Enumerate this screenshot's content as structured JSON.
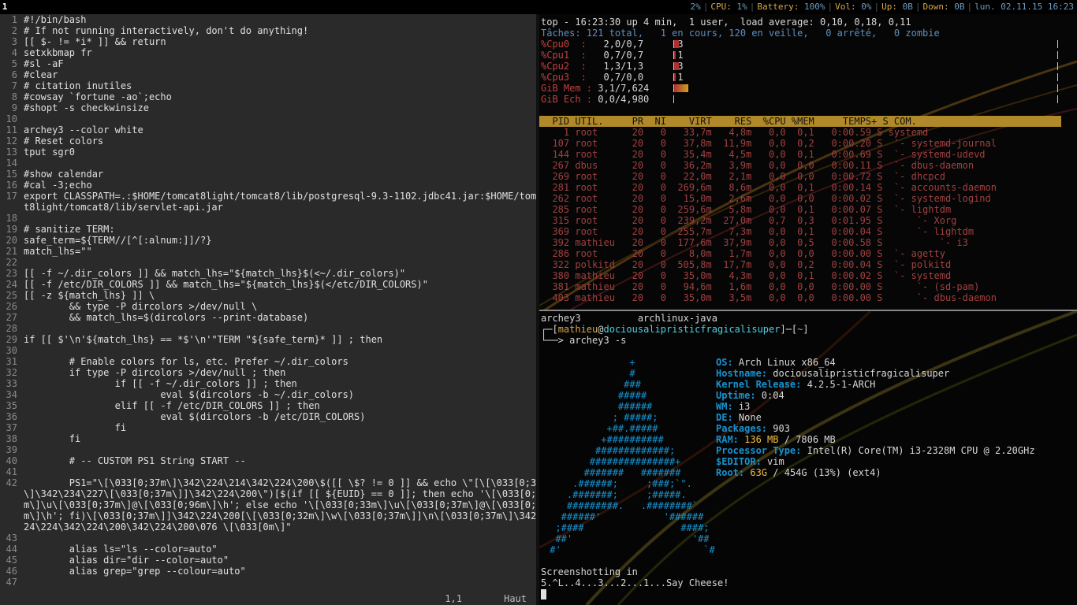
{
  "topbar": {
    "workspace": "1",
    "status": [
      {
        "label": "",
        "value": "2%"
      },
      {
        "label": "CPU:",
        "value": "1%"
      },
      {
        "label": "Battery:",
        "value": "100%"
      },
      {
        "label": "Vol:",
        "value": "0%"
      },
      {
        "label": "Up:",
        "value": "0B"
      },
      {
        "label": "Down:",
        "value": "0B"
      },
      {
        "label": "",
        "value": "lun. 02.11.15  16:23"
      }
    ]
  },
  "vim": {
    "lines": [
      {
        "n": "1",
        "t": "#!/bin/bash",
        "c": "comment"
      },
      {
        "n": "2",
        "t": "# If not running interactively, don't do anything!",
        "c": "comment"
      },
      {
        "n": "3",
        "t": "[[ $- != *i* ]] && return",
        "c": "kw"
      },
      {
        "n": "4",
        "t": "setxkbmap fr",
        "c": ""
      },
      {
        "n": "5",
        "t": "#sl -aF",
        "c": "comment"
      },
      {
        "n": "6",
        "t": "#clear",
        "c": "comment"
      },
      {
        "n": "7",
        "t": "# citation inutiles",
        "c": "comment"
      },
      {
        "n": "8",
        "t": "#cowsay `fortune -ao`;echo",
        "c": "comment"
      },
      {
        "n": "9",
        "t": "#shopt -s checkwinsize",
        "c": "comment"
      },
      {
        "n": "10",
        "t": "",
        "c": ""
      },
      {
        "n": "11",
        "t": "archey3 --color white",
        "c": ""
      },
      {
        "n": "12",
        "t": "# Reset colors",
        "c": "comment"
      },
      {
        "n": "13",
        "t": "tput sgr0",
        "c": ""
      },
      {
        "n": "14",
        "t": "",
        "c": ""
      },
      {
        "n": "15",
        "t": "#show calendar",
        "c": "comment"
      },
      {
        "n": "16",
        "t": "#cal -3;echo",
        "c": "comment"
      },
      {
        "n": "17",
        "t": "export CLASSPATH=.:$HOME/tomcat8light/tomcat8/lib/postgresql-9.3-1102.jdbc41.jar:$HOME/tomca",
        "c": "var"
      },
      {
        "n": "",
        "t": "t8light/tomcat8/lib/servlet-api.jar",
        "c": ""
      },
      {
        "n": "18",
        "t": "",
        "c": ""
      },
      {
        "n": "19",
        "t": "# sanitize TERM:",
        "c": "comment"
      },
      {
        "n": "20",
        "t": "safe_term=${TERM//[^[:alnum:]]/?}",
        "c": "var"
      },
      {
        "n": "21",
        "t": "match_lhs=\"\"",
        "c": "var"
      },
      {
        "n": "22",
        "t": "",
        "c": ""
      },
      {
        "n": "23",
        "t": "[[ -f ~/.dir_colors ]] && match_lhs=\"${match_lhs}$(<~/.dir_colors)\"",
        "c": "str"
      },
      {
        "n": "24",
        "t": "[[ -f /etc/DIR_COLORS ]] && match_lhs=\"${match_lhs}$(</etc/DIR_COLORS)\"",
        "c": "str"
      },
      {
        "n": "25",
        "t": "[[ -z ${match_lhs} ]] \\",
        "c": "kw"
      },
      {
        "n": "26",
        "t": "        && type -P dircolors >/dev/null \\",
        "c": ""
      },
      {
        "n": "27",
        "t": "        && match_lhs=$(dircolors --print-database)",
        "c": ""
      },
      {
        "n": "28",
        "t": "",
        "c": ""
      },
      {
        "n": "29",
        "t": "if [[ $'\\n'${match_lhs} == *$'\\n'\"TERM \"${safe_term}* ]] ; then",
        "c": "kw"
      },
      {
        "n": "30",
        "t": "",
        "c": ""
      },
      {
        "n": "31",
        "t": "        # Enable colors for ls, etc. Prefer ~/.dir_colors",
        "c": "comment"
      },
      {
        "n": "32",
        "t": "        if type -P dircolors >/dev/null ; then",
        "c": "kw"
      },
      {
        "n": "33",
        "t": "                if [[ -f ~/.dir_colors ]] ; then",
        "c": "kw"
      },
      {
        "n": "34",
        "t": "                        eval $(dircolors -b ~/.dir_colors)",
        "c": "path"
      },
      {
        "n": "35",
        "t": "                elif [[ -f /etc/DIR_COLORS ]] ; then",
        "c": "kw"
      },
      {
        "n": "36",
        "t": "                        eval $(dircolors -b /etc/DIR_COLORS)",
        "c": "path"
      },
      {
        "n": "37",
        "t": "                fi",
        "c": "kw"
      },
      {
        "n": "38",
        "t": "        fi",
        "c": "kw"
      },
      {
        "n": "39",
        "t": "",
        "c": ""
      },
      {
        "n": "40",
        "t": "        # -- CUSTOM PS1 String START --",
        "c": "comment"
      },
      {
        "n": "41",
        "t": "",
        "c": ""
      },
      {
        "n": "42",
        "t": "        PS1=\"\\[\\033[0;37m\\]\\342\\224\\214\\342\\224\\200\\$([[ \\$? != 0 ]] && echo \\\"[\\[\\033[0;31m",
        "c": "str"
      },
      {
        "n": "",
        "t": "\\]\\342\\234\\227\\[\\033[0;37m\\]]\\342\\224\\200\\\")[$(if [[ ${EUID} == 0 ]]; then echo '\\[\\033[0;39",
        "c": "str"
      },
      {
        "n": "",
        "t": "m\\]\\u\\[\\033[0;37m\\]@\\[\\033[0;96m\\]\\h'; else echo '\\[\\033[0;33m\\]\\u\\[\\033[0;37m\\]@\\[\\033[0;96",
        "c": "str"
      },
      {
        "n": "",
        "t": "m\\]\\h'; fi)\\[\\033[0;37m\\]]\\342\\224\\200[\\[\\033[0;32m\\]\\w\\[\\033[0;37m\\]]\\n\\[\\033[0;37m\\]\\342\\2",
        "c": "str"
      },
      {
        "n": "",
        "t": "24\\224\\342\\224\\200\\342\\224\\200\\076 \\[\\033[0m\\]\"",
        "c": "str"
      },
      {
        "n": "43",
        "t": "",
        "c": ""
      },
      {
        "n": "44",
        "t": "        alias ls=\"ls --color=auto\"",
        "c": "str"
      },
      {
        "n": "45",
        "t": "        alias dir=\"dir --color=auto\"",
        "c": "str"
      },
      {
        "n": "46",
        "t": "        alias grep=\"grep --colour=auto\"",
        "c": "str"
      },
      {
        "n": "47",
        "t": "",
        "c": ""
      }
    ],
    "status_position": "1,1",
    "status_scroll": "Haut"
  },
  "top": {
    "header": "top - 16:23:30 up 4 min,  1 user,  load average: 0,10, 0,18, 0,11",
    "tasks": "Tâches: 121 total,   1 en cours, 120 en veille,   0 arrêté,   0 zombie",
    "cpus": [
      {
        "label": "%Cpu0  :",
        "value": "2,0/0,7",
        "num": "3"
      },
      {
        "label": "%Cpu1  :",
        "value": "0,7/0,7",
        "num": "1"
      },
      {
        "label": "%Cpu2  :",
        "value": "1,3/1,3",
        "num": "3"
      },
      {
        "label": "%Cpu3  :",
        "value": "0,7/0,0",
        "num": "1"
      }
    ],
    "mem": {
      "label": "GiB Mem :",
      "value": "3,1/7,624"
    },
    "swap": {
      "label": "GiB Ech :",
      "value": "0,0/4,980"
    },
    "columns": "  PID UTIL.     PR  NI    VIRT    RES  %CPU %MEM     TEMPS+ S COM.",
    "rows": [
      "    1 root      20   0   33,7m   4,8m   0,0  0,1   0:00.59 S systemd",
      "  107 root      20   0   37,8m  11,9m   0,0  0,2   0:00.20 S  `- systemd-journal",
      "  144 root      20   0   35,4m   4,5m   0,0  0,1   0:00.69 S  `- systemd-udevd",
      "  267 dbus      20   0   36,2m   3,9m   0,0  0,0   0:00.11 S  `- dbus-daemon",
      "  269 root      20   0   22,0m   2,1m   0,0  0,0   0:00.72 S  `- dhcpcd",
      "  281 root      20   0  269,6m   8,6m   0,0  0,1   0:00.14 S  `- accounts-daemon",
      "  262 root      20   0   15,0m   2,6m   0,0  0,0   0:00.02 S  `- systemd-logind",
      "  285 root      20   0  259,6m   5,8m   0,0  0,1   0:00.07 S  `- lightdm",
      "  315 root      20   0  239,2m  27,0m   0,7  0,3   0:01.95 S      `- Xorg",
      "  369 root      20   0  255,7m   7,3m   0,0  0,1   0:00.04 S      `- lightdm",
      "  392 mathieu   20   0  177,6m  37,9m   0,0  0,5   0:00.58 S          `- i3",
      "  286 root      20   0    8,0m   1,7m   0,0  0,0   0:00.00 S  `- agetty",
      "  322 polkitd   20   0  505,8m  17,7m   0,0  0,2   0:00.04 S  `- polkitd",
      "  380 mathieu   20   0   35,0m   4,3m   0,0  0,1   0:00.02 S  `- systemd",
      "  381 mathieu   20   0   94,6m   1,6m   0,0  0,0   0:00.00 S      `- (sd-pam)",
      "  403 mathieu   20   0   35,0m   3,5m   0,0  0,0   0:00.00 S      `- dbus-daemon"
    ]
  },
  "term": {
    "line1": "archey3          archlinux-java",
    "prompt_user": "mathieu",
    "prompt_at": "@",
    "prompt_host": "dociousalipristicfragicalisuper",
    "prompt_dir": "~",
    "command": "archey3 -s",
    "logo": [
      "               +",
      "               #",
      "              ###",
      "             #####",
      "             ######",
      "            ; #####;",
      "           +##.#####",
      "          +##########",
      "         #############;",
      "        ###############+",
      "       #######   #######",
      "     .######;     ;###;`\".",
      "    .#######;     ;#####.",
      "    #########.   .########`",
      "   ######'           '######",
      "  ;####                 ####;",
      "  ##'                     '##",
      " #'                         `#"
    ],
    "info": [
      {
        "key": "OS:",
        "val": "Arch Linux x86_64",
        "hl": ""
      },
      {
        "key": "Hostname:",
        "val": "dociousalipristicfragicalisuper",
        "hl": ""
      },
      {
        "key": "Kernel Release:",
        "val": "4.2.5-1-ARCH",
        "hl": ""
      },
      {
        "key": "Uptime:",
        "val": "0:04",
        "hl": ""
      },
      {
        "key": "WM:",
        "val": "i3",
        "hl": ""
      },
      {
        "key": "DE:",
        "val": "None",
        "hl": ""
      },
      {
        "key": "Packages:",
        "val": "903",
        "hl": ""
      },
      {
        "key": "RAM:",
        "val": " / 7806 MB",
        "hl": "136 MB"
      },
      {
        "key": "Processor Type:",
        "val": "Intel(R) Core(TM) i3-2328M CPU @ 2.20GHz",
        "hl": ""
      },
      {
        "key": "$EDITOR:",
        "val": "vim",
        "hl": ""
      },
      {
        "key": "Root:",
        "val": " / 454G (13%) (ext4)",
        "hl": "63G"
      }
    ],
    "screenshot1": "Screenshotting in",
    "screenshot2": "5.^L..4...3...2...1...Say Cheese!"
  },
  "colors": {
    "accent_blue": "#1793d1",
    "top_header_bar": "#b08a2a",
    "keyword": "#e8409a"
  }
}
